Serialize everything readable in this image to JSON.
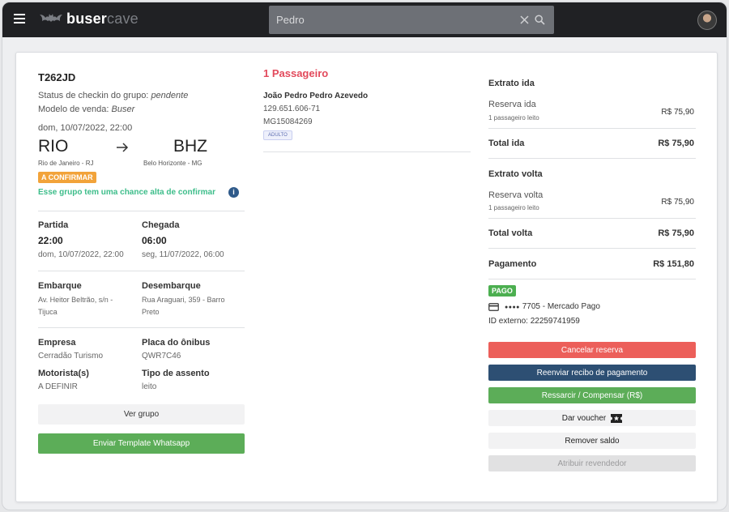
{
  "header": {
    "logo_primary": "buser",
    "logo_secondary": "cave",
    "search_value": "Pedro"
  },
  "trip": {
    "code": "T262JD",
    "checkin_label": "Status de checkin do grupo:",
    "checkin_value": "pendente",
    "sale_label": "Modelo de venda:",
    "sale_value": "Buser",
    "datetime": "dom, 10/07/2022, 22:00",
    "origin_code": "RIO",
    "origin_city": "Rio de Janeiro - RJ",
    "dest_code": "BHZ",
    "dest_city": "Belo Horizonte - MG",
    "status_badge": "A CONFIRMAR",
    "confirm_note": "Esse grupo tem uma chance alta de confirmar",
    "departure_label": "Partida",
    "departure_time": "22:00",
    "departure_date": "dom, 10/07/2022, 22:00",
    "arrival_label": "Chegada",
    "arrival_time": "06:00",
    "arrival_date": "seg, 11/07/2022, 06:00",
    "board_label": "Embarque",
    "board_addr1": "Av. Heitor Beltrão, s/n -",
    "board_addr2": "Tijuca",
    "alight_label": "Desembarque",
    "alight_addr1": "Rua Araguari, 359 - Barro",
    "alight_addr2": "Preto",
    "company_label": "Empresa",
    "company_value": "Cerradão Turismo",
    "plate_label": "Placa do ônibus",
    "plate_value": "QWR7C46",
    "driver_label": "Motorista(s)",
    "driver_value": "A DEFINIR",
    "seat_label": "Tipo de assento",
    "seat_value": "leito",
    "see_group_btn": "Ver grupo",
    "whatsapp_btn": "Enviar Template Whatsapp"
  },
  "passengers": {
    "title": "1 Passageiro",
    "name": "João Pedro Pedro Azevedo",
    "cpf": "129.651.606-71",
    "rg": "MG15084269",
    "type_badge": "ADULTO"
  },
  "statement": {
    "outbound_title": "Extrato ida",
    "outbound_item": "Reserva ida",
    "outbound_sub": "1 passageiro leito",
    "outbound_value": "R$ 75,90",
    "outbound_total_label": "Total ida",
    "outbound_total_value": "R$ 75,90",
    "return_title": "Extrato volta",
    "return_item": "Reserva volta",
    "return_sub": "1 passageiro leito",
    "return_value": "R$ 75,90",
    "return_total_label": "Total volta",
    "return_total_value": "R$ 75,90",
    "payment_label": "Pagamento",
    "payment_value": "R$ 151,80",
    "paid_badge": "PAGO",
    "card_dots": "●●●●",
    "card_info": "7705 - Mercado Pago",
    "external_id": "ID externo: 22259741959"
  },
  "actions": {
    "cancel": "Cancelar reserva",
    "resend": "Reenviar recibo de pagamento",
    "refund": "Ressarcir / Compensar (R$)",
    "voucher": "Dar voucher",
    "remove_balance": "Remover saldo",
    "assign_reseller": "Atribuir revendedor"
  },
  "colors": {
    "orange": "#f2a33a",
    "green_text": "#3dbd8a",
    "red_title": "#e2495b",
    "btn_red": "#ec5f5a",
    "btn_blue": "#2d4f73",
    "btn_green": "#5cad58",
    "paid_green": "#4caf50",
    "info_blue": "#2f5a8a"
  }
}
